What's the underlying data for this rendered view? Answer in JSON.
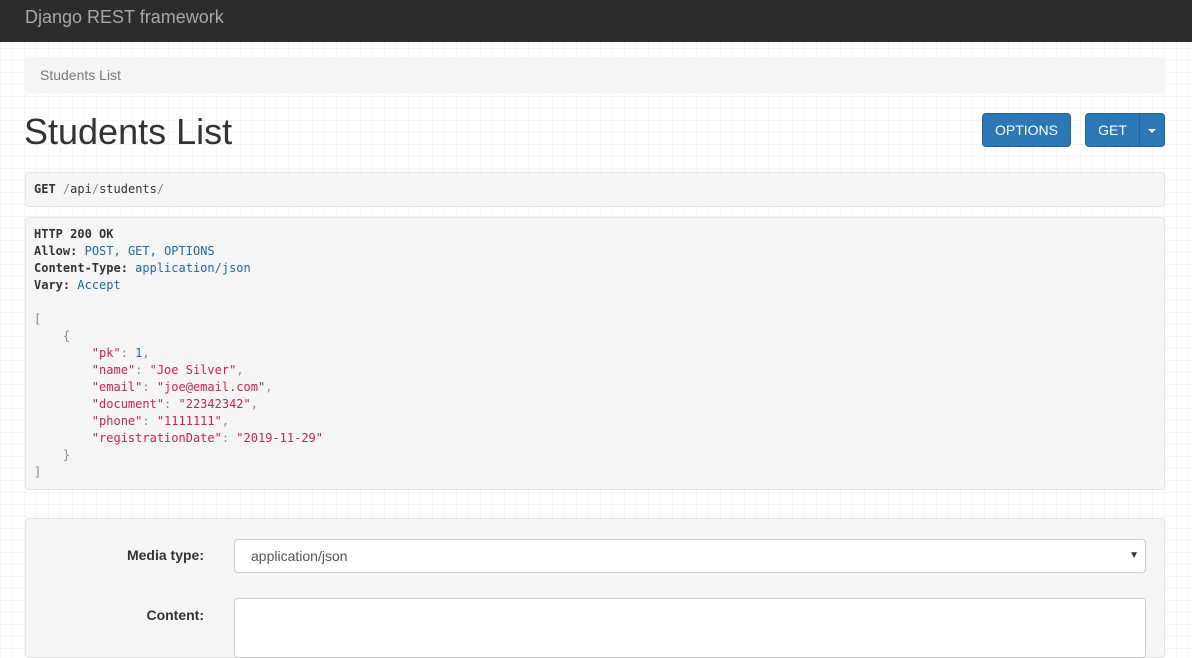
{
  "navbar": {
    "brand": "Django REST framework"
  },
  "breadcrumb": {
    "item": "Students List"
  },
  "page": {
    "title": "Students List"
  },
  "buttons": {
    "options": "OPTIONS",
    "get": "GET"
  },
  "request": {
    "method": "GET",
    "slash1": "/",
    "segment1": "api",
    "slash2": "/",
    "segment2": "students",
    "slash3": "/"
  },
  "response": {
    "status": "HTTP 200 OK",
    "headers": [
      {
        "name": "Allow:",
        "value": "POST, GET, OPTIONS"
      },
      {
        "name": "Content-Type:",
        "value": "application/json"
      },
      {
        "name": "Vary:",
        "value": "Accept"
      }
    ],
    "body": {
      "open_bracket": "[",
      "open_brace": "{",
      "fields": [
        {
          "key": "\"pk\"",
          "value": "1",
          "type": "num"
        },
        {
          "key": "\"name\"",
          "value": "\"Joe Silver\"",
          "type": "str"
        },
        {
          "key": "\"email\"",
          "value": "\"joe@email.com\"",
          "type": "str"
        },
        {
          "key": "\"document\"",
          "value": "\"22342342\"",
          "type": "str"
        },
        {
          "key": "\"phone\"",
          "value": "\"1111111\"",
          "type": "str"
        },
        {
          "key": "\"registrationDate\"",
          "value": "\"2019-11-29\"",
          "type": "str"
        }
      ],
      "close_brace": "}",
      "close_bracket": "]"
    }
  },
  "form": {
    "media_type_label": "Media type:",
    "media_type_value": "application/json",
    "content_label": "Content:"
  },
  "colors": {
    "navbar": "#2c2c2c",
    "primary_button": "#2c77b5",
    "json_string": "#c7254e",
    "json_number": "#1c6aa1"
  }
}
